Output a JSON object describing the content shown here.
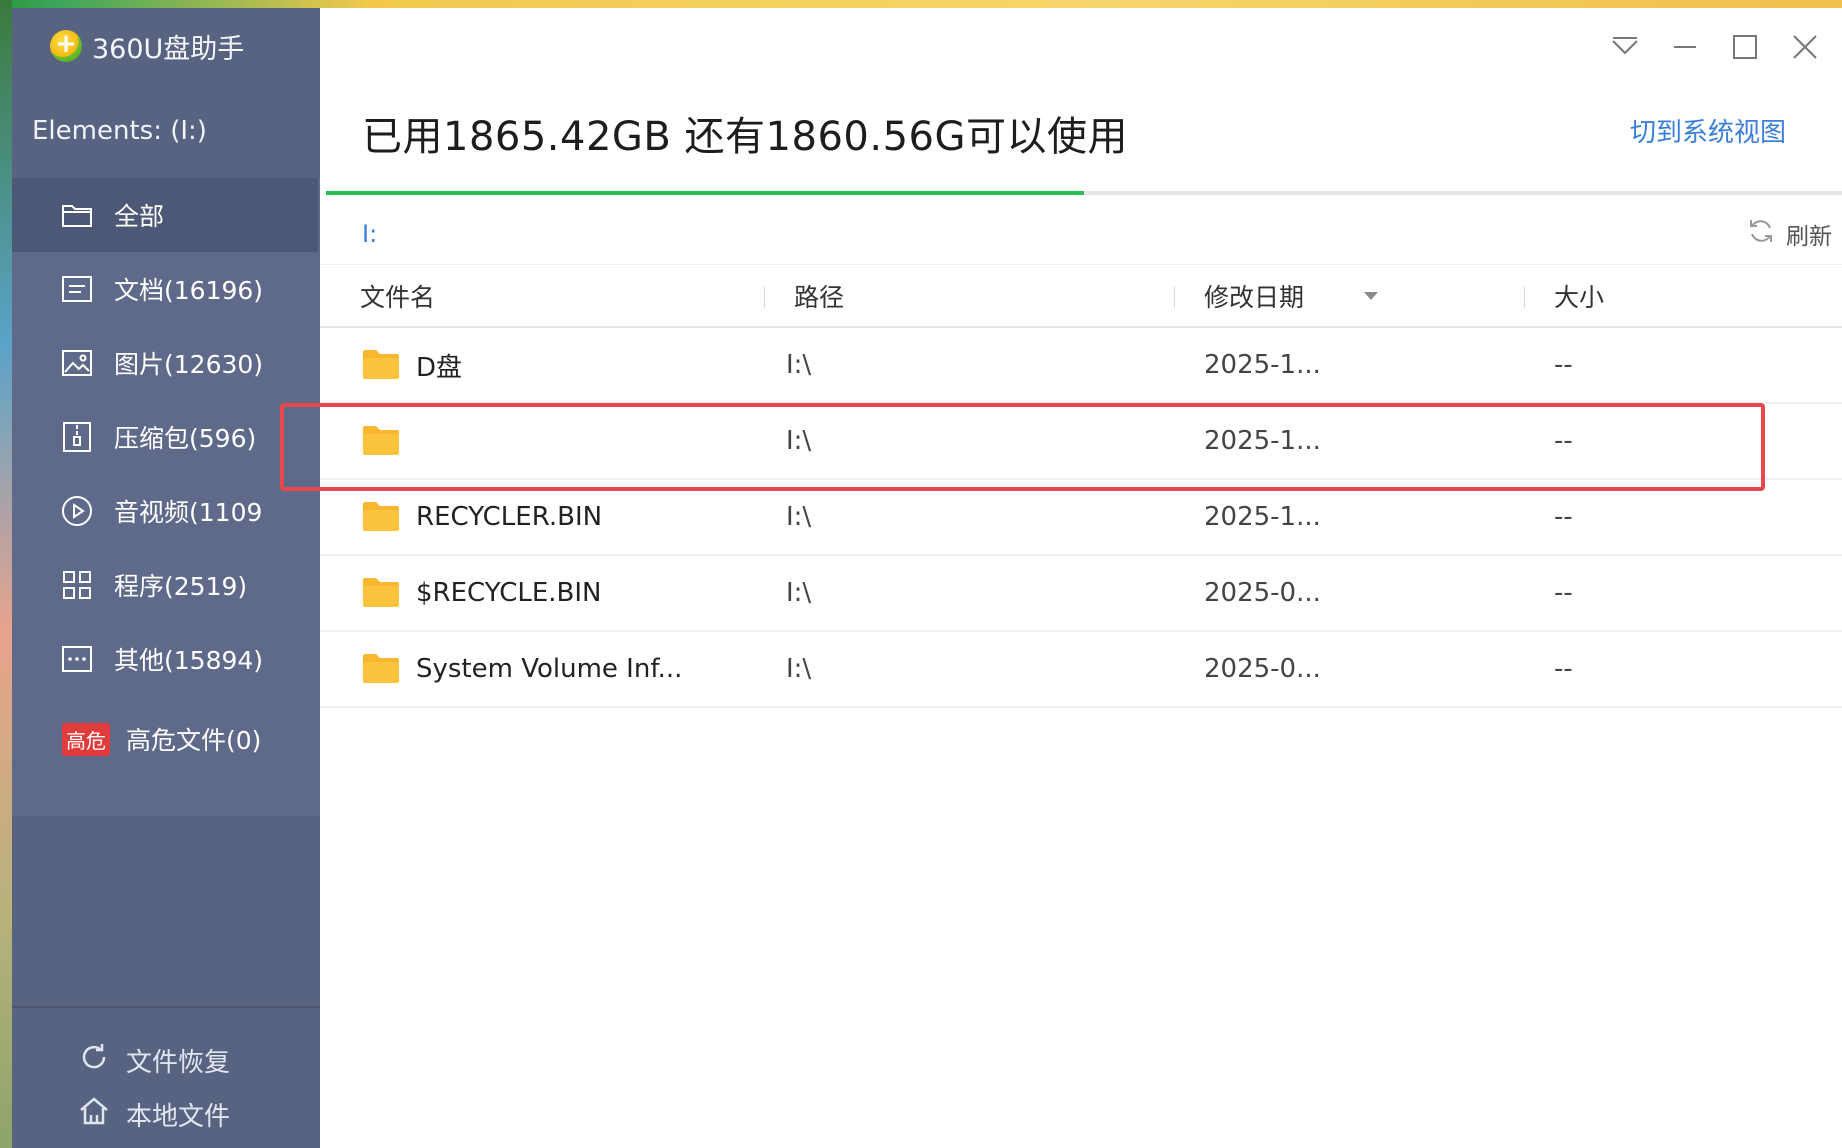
{
  "app": {
    "title": "360U盘助手"
  },
  "drive": {
    "label": "Elements: (I:)"
  },
  "nav": {
    "items": [
      {
        "label": "全部",
        "icon": "folder-icon"
      },
      {
        "label": "文档(16196)",
        "icon": "document-icon"
      },
      {
        "label": "图片(12630)",
        "icon": "image-icon"
      },
      {
        "label": "压缩包(596)",
        "icon": "archive-icon"
      },
      {
        "label": "音视频(1109",
        "icon": "play-icon"
      },
      {
        "label": "程序(2519)",
        "icon": "grid-icon"
      },
      {
        "label": "其他(15894)",
        "icon": "more-icon"
      }
    ],
    "danger": {
      "badge": "高危",
      "label": "高危文件(0)"
    }
  },
  "bottom_links": {
    "recover": "文件恢复",
    "local": "本地文件"
  },
  "header": {
    "usage_text": "已用1865.42GB 还有1860.56G可以使用",
    "usage_fraction": 0.5,
    "switch_view": "切到系统视图",
    "usage_color": "#2dbd55"
  },
  "breadcrumb": {
    "path": "I:"
  },
  "toolbar": {
    "refresh": "刷新"
  },
  "table": {
    "columns": {
      "name": "文件名",
      "path": "路径",
      "date": "修改日期",
      "size": "大小"
    },
    "rows": [
      {
        "name": "D盘",
        "path": "I:\\",
        "date": "2025-1...",
        "size": "--"
      },
      {
        "name": "",
        "path": "I:\\",
        "date": "2025-1...",
        "size": "--"
      },
      {
        "name": "RECYCLER.BIN",
        "path": "I:\\",
        "date": "2025-1...",
        "size": "--"
      },
      {
        "name": "$RECYCLE.BIN",
        "path": "I:\\",
        "date": "2025-0...",
        "size": "--"
      },
      {
        "name": "System Volume Inf...",
        "path": "I:\\",
        "date": "2025-0...",
        "size": "--"
      }
    ]
  },
  "colors": {
    "sidebar": "#586382",
    "accent": "#3a7fd9",
    "highlight": "#e8474b",
    "danger": "#e23b3b"
  }
}
